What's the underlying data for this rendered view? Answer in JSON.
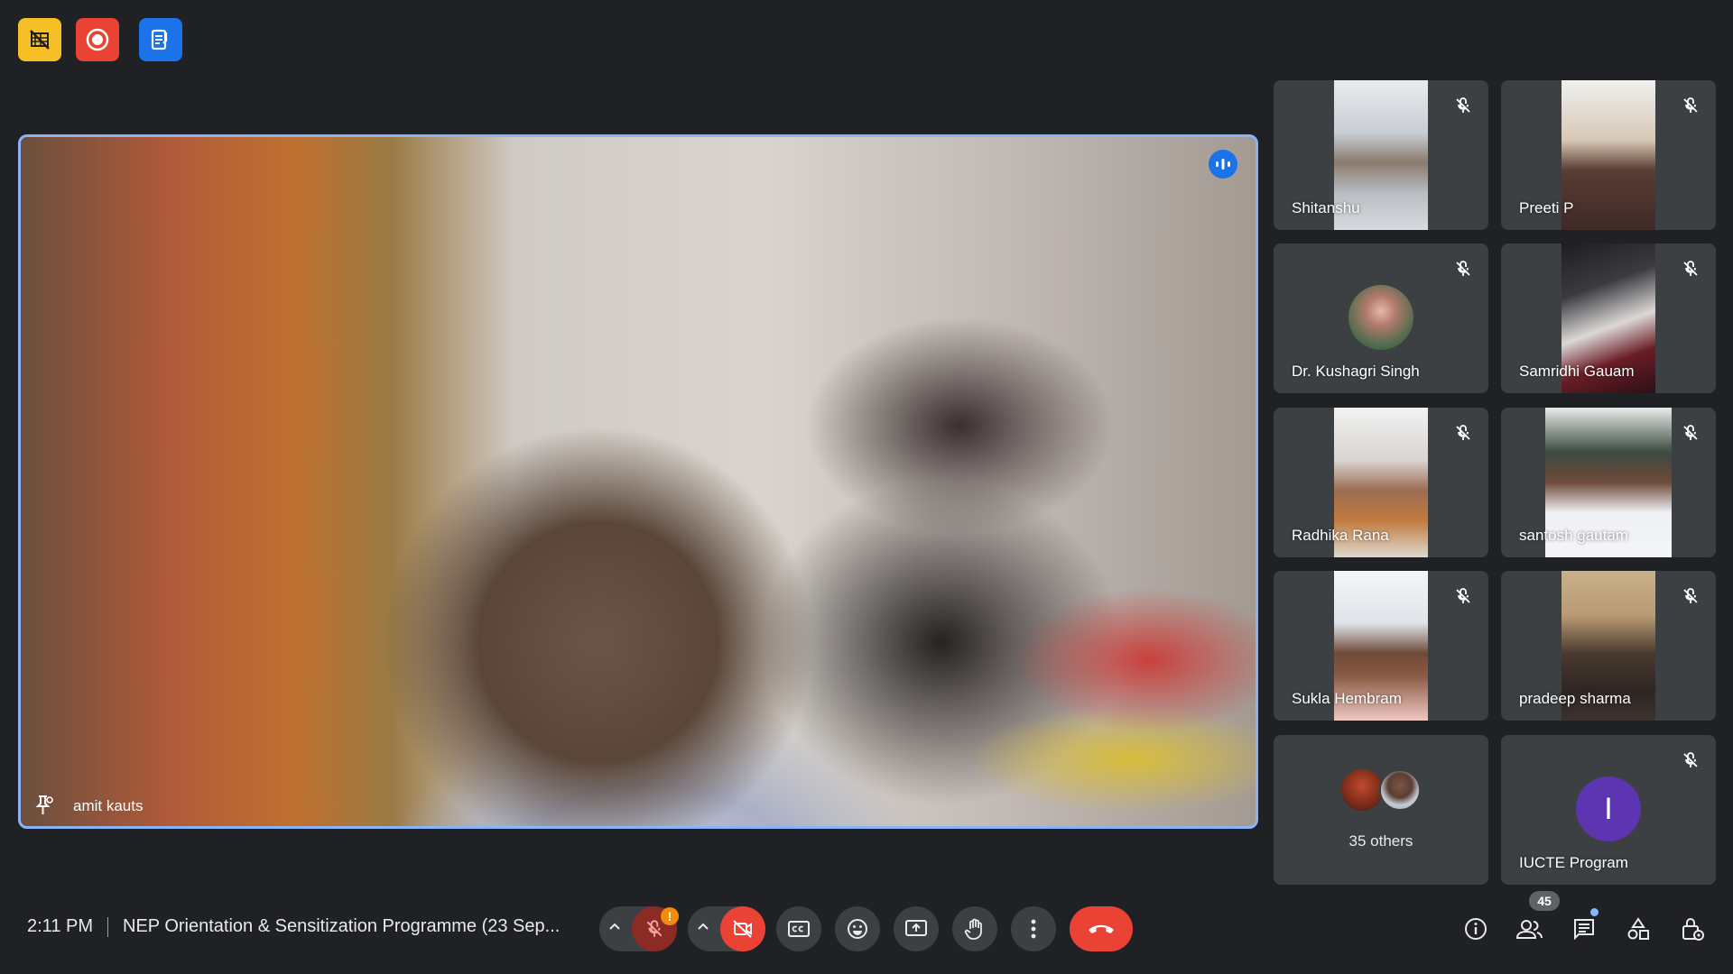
{
  "top_icons": [
    {
      "name": "no-video-layout-icon",
      "color": "#f6bf26"
    },
    {
      "name": "recording-icon",
      "color": "#ea4335"
    },
    {
      "name": "transcript-icon",
      "color": "#1a73e8"
    }
  ],
  "main_speaker": {
    "name": "amit kauts",
    "speaking": true
  },
  "participants": [
    {
      "name": "Shitanshu",
      "muted": true
    },
    {
      "name": "Preeti P",
      "muted": true
    },
    {
      "name": "Dr. Kushagri Singh",
      "muted": true
    },
    {
      "name": "Samridhi Gauam",
      "muted": true
    },
    {
      "name": "Radhika Rana",
      "muted": true
    },
    {
      "name": "santosh gautam",
      "muted": true
    },
    {
      "name": "Sukla Hembram",
      "muted": true
    },
    {
      "name": "pradeep sharma",
      "muted": true
    }
  ],
  "others_tile": {
    "label": "35 others"
  },
  "program_tile": {
    "name": "IUCTE Program",
    "initial": "I",
    "muted": true
  },
  "bottom_bar": {
    "time": "2:11 PM",
    "meeting_title": "NEP Orientation & Sensitization Programme (23 Sep...",
    "mic_warning": "!",
    "participant_count": "45"
  },
  "colors": {
    "background": "#202124",
    "tile": "#3c4043",
    "accent": "#8ab4f8",
    "hangup": "#ea4335"
  }
}
